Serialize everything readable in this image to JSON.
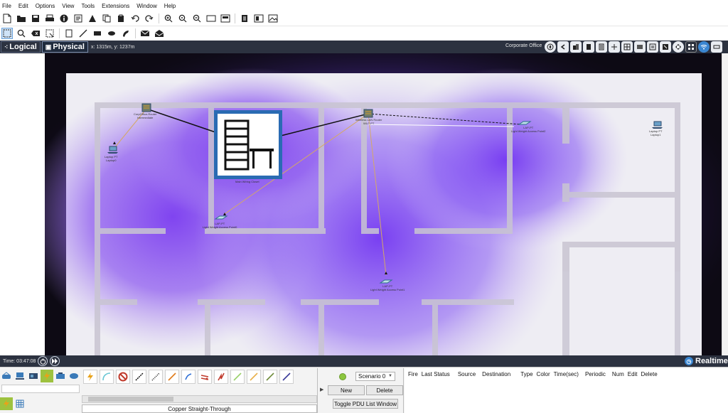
{
  "menu": [
    "File",
    "Edit",
    "Options",
    "View",
    "Tools",
    "Extensions",
    "Window",
    "Help"
  ],
  "toolbar_top": {
    "icons": [
      "new-file-icon",
      "open-folder-icon",
      "save-icon",
      "print-icon",
      "info-icon",
      "activity-wizard-icon",
      "network-info-icon",
      "copy-icon",
      "paste-icon",
      "undo-icon",
      "redo-icon",
      "zoom-in-icon",
      "zoom-reset-icon",
      "zoom-out-icon",
      "drawing-palette-icon",
      "custom-devices-icon",
      "notes-icon",
      "view-icon",
      "screenshot-icon"
    ]
  },
  "toolbar_edit": {
    "icons": [
      "select-icon",
      "inspect-icon",
      "delete-icon",
      "resize-icon",
      "place-note-icon",
      "draw-line-icon",
      "draw-rectangle-icon",
      "draw-ellipse-icon",
      "freeform-icon",
      "add-simple-pdu-icon",
      "add-complex-pdu-icon"
    ]
  },
  "modebar": {
    "logical_label": "Logical",
    "physical_label": "Physical",
    "coords": "x: 1315m, y: 1237m",
    "location": "Corporate Office"
  },
  "workspace": {
    "devices": [
      {
        "label": "CorpOffice-Router\nIntermediate"
      },
      {
        "label": "Laptop PT\nLaptop0"
      },
      {
        "label": "Main Wiring Closet"
      },
      {
        "label": "LAP-PT\nLight Weight Access Point0"
      },
      {
        "label": "Wireless LAN Router\nWLC-PT"
      },
      {
        "label": "LAP-PT\nLight Weight Access Point2"
      },
      {
        "label": "LAP-PT\nLight Weight Access Point1"
      },
      {
        "label": "Laptop PT\nLaptop1"
      }
    ]
  },
  "status": {
    "time": "Time: 03:47:08",
    "realtime_label": "Realtime"
  },
  "device_categories": {
    "row1": [
      "network-devices-icon",
      "end-devices-icon",
      "components-icon",
      "connections-icon",
      "misc-icon",
      "multiuser-icon"
    ],
    "row2": [
      "connections-icon",
      "grid-icon"
    ]
  },
  "cables": {
    "items": [
      "automatic-connection-icon",
      "console-cable-icon",
      "no-connection-icon",
      "copper-straight-icon",
      "copper-cross-icon",
      "fiber-icon",
      "phone-cable-icon",
      "coaxial-icon",
      "serial-dce-icon",
      "serial-dte-icon",
      "octal-cable-icon",
      "iot-custom-cable-icon",
      "usb-cable-icon"
    ],
    "selected_name": "Copper Straight-Through"
  },
  "simulation": {
    "scenario": "Scenario 0",
    "new_label": "New",
    "delete_label": "Delete",
    "toggle_label": "Toggle PDU List Window"
  },
  "pdu_list": {
    "columns": [
      "Fire",
      "Last Status",
      "Source",
      "Destination",
      "Type",
      "Color",
      "Time(sec)",
      "Periodic",
      "Num",
      "Edit",
      "Delete"
    ]
  }
}
